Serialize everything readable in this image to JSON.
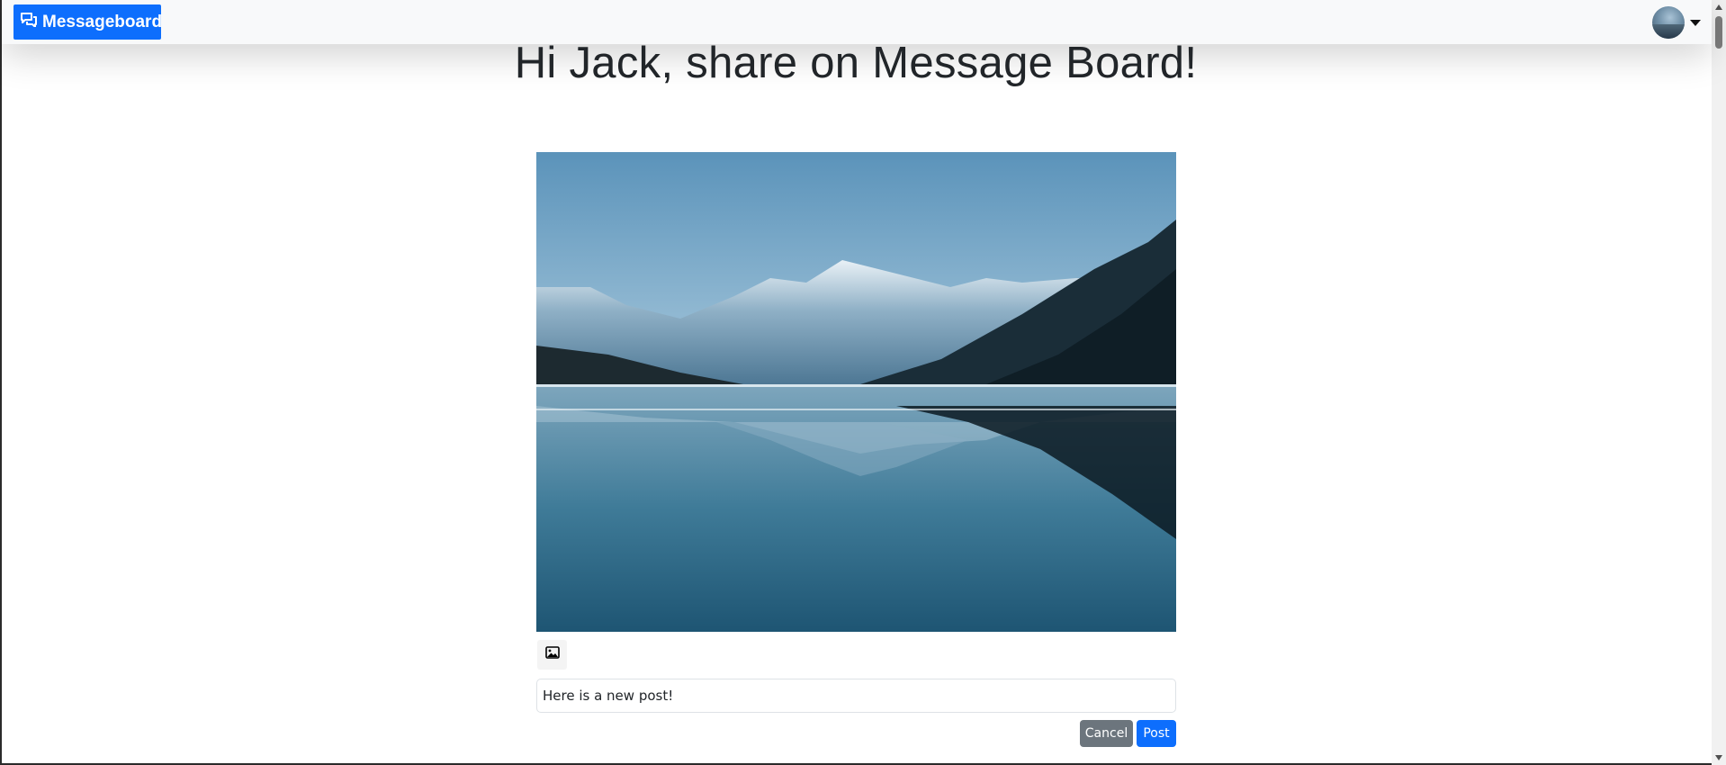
{
  "navbar": {
    "brand_label": "Messageboard",
    "brand_icon": "chat-bubbles-icon",
    "user_menu_icon": "caret-down-icon"
  },
  "page": {
    "heading": "Hi Jack, share on Message Board!"
  },
  "composer": {
    "image_button_icon": "image-icon",
    "post_text": "Here is a new post!",
    "cancel_label": "Cancel",
    "post_label": "Post"
  },
  "colors": {
    "primary": "#0d6efd",
    "secondary": "#6c757d",
    "navbar_bg": "#f8f9fa"
  }
}
